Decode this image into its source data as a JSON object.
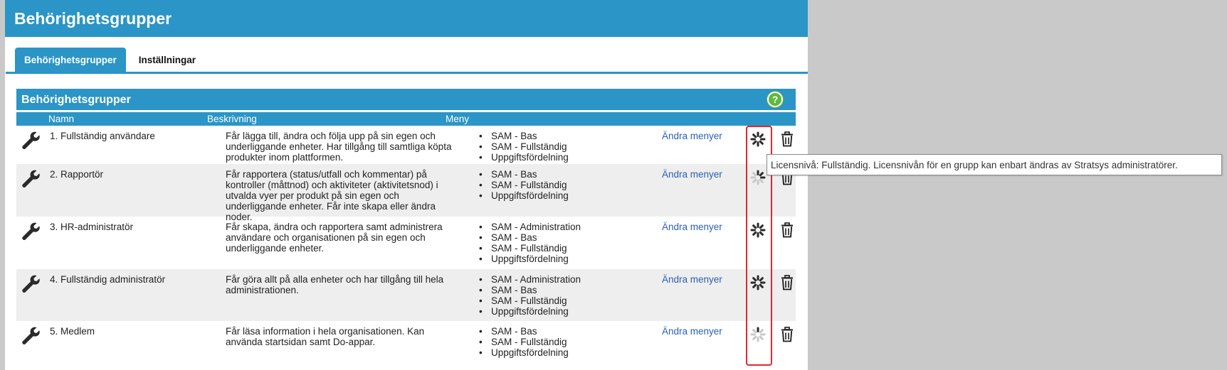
{
  "page": {
    "title": "Behörighetsgrupper"
  },
  "tabs": [
    {
      "label": "Behörighetsgrupper",
      "active": true
    },
    {
      "label": "Inställningar",
      "active": false
    }
  ],
  "section": {
    "title": "Behörighetsgrupper",
    "help_icon": "help-icon"
  },
  "columns": {
    "name": "Namn",
    "description": "Beskrivning",
    "menu": "Meny"
  },
  "rows": [
    {
      "name": "1. Fullständig användare",
      "description": "Får lägga till, ändra och följa upp på sin egen och underliggande enheter. Har tillgång till samtliga köpta produkter inom plattformen.",
      "menus": [
        "SAM - Bas",
        "SAM - Fullständig",
        "Uppgiftsfördelning"
      ],
      "link": "Ändra menyer",
      "license": "full"
    },
    {
      "name": "2. Rapportör",
      "description": "Får rapportera (status/utfall och kommentar) på kontroller (måttnod) och aktiviteter (aktivitetsnod) i utvalda vyer per produkt på sin egen och underliggande enheter. Får inte skapa eller ändra noder.",
      "menus": [
        "SAM - Bas",
        "SAM - Fullständig",
        "Uppgiftsfördelning"
      ],
      "link": "Ändra menyer",
      "license": "partial"
    },
    {
      "name": "3. HR-administratör",
      "description": "Får skapa, ändra och rapportera samt administrera användare och organisationen på sin egen och underliggande enheter.",
      "menus": [
        "SAM - Administration",
        "SAM - Bas",
        "SAM - Fullständig",
        "Uppgiftsfördelning"
      ],
      "link": "Ändra menyer",
      "license": "full"
    },
    {
      "name": "4. Fullständig administratör",
      "description": "Får göra allt på alla enheter och har tillgång till hela administrationen.",
      "menus": [
        "SAM - Administration",
        "SAM - Bas",
        "SAM - Fullständig",
        "Uppgiftsfördelning"
      ],
      "link": "Ändra menyer",
      "license": "full"
    },
    {
      "name": "5. Medlem",
      "description": "Får läsa information i hela organisationen. Kan använda startsidan samt Do-appar.",
      "menus": [
        "SAM - Bas",
        "SAM - Fullständig",
        "Uppgiftsfördelning"
      ],
      "link": "Ändra menyer",
      "license": "low"
    }
  ],
  "tooltip": "Licensnivå: Fullständig. Licensnivån för en grupp kan enbart ändras av Stratsys administratörer.",
  "colors": {
    "accent": "#2a95c6",
    "link": "#2b5fb4",
    "highlight": "#e0282e",
    "help": "#5fb83c"
  }
}
